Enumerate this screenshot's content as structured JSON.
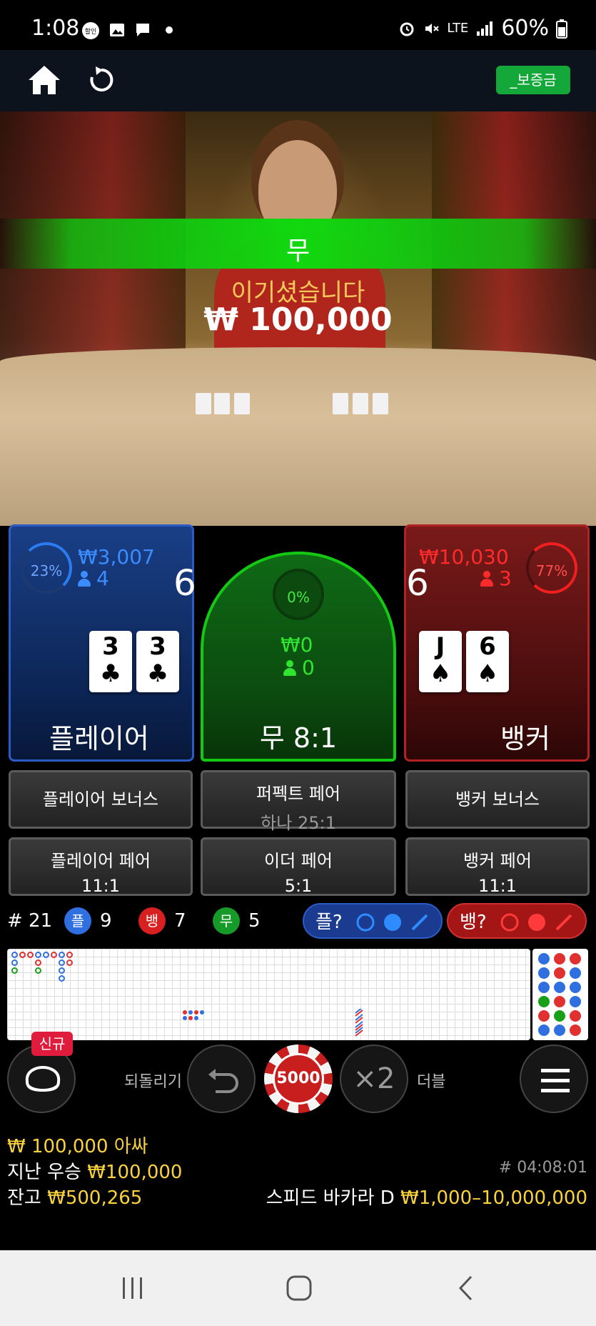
{
  "status_bar": {
    "time": "1:08",
    "network": "LTE",
    "battery": "60%"
  },
  "nav": {
    "deposit_label": "_보증금"
  },
  "video": {
    "result": "무",
    "win_label": "이기셨습니다",
    "win_amount": "₩ 100,000"
  },
  "player": {
    "percent": "23%",
    "amount": "₩3,007",
    "count": "4",
    "score": "6",
    "cards": [
      {
        "rank": "3",
        "suit": "♣"
      },
      {
        "rank": "3",
        "suit": "♣"
      }
    ],
    "label": "플레이어"
  },
  "tie": {
    "percent": "0%",
    "amount": "₩0",
    "count": "0",
    "label": "무 8:1"
  },
  "banker": {
    "percent": "77%",
    "amount": "₩10,030",
    "count": "3",
    "score": "6",
    "cards": [
      {
        "rank": "J",
        "suit": "♠"
      },
      {
        "rank": "6",
        "suit": "♠"
      }
    ],
    "label": "뱅커"
  },
  "side_bets": {
    "player_bonus": "플레이어 보너스",
    "perfect_pair": "퍼펙트 페어",
    "perfect_pair_sub": "하나 25:1",
    "banker_bonus": "뱅커 보너스",
    "player_pair": "플레이어 페어",
    "player_pair_odds": "11:1",
    "either_pair": "이더 페어",
    "either_pair_odds": "5:1",
    "banker_pair": "뱅커 페어",
    "banker_pair_odds": "11:1"
  },
  "stats": {
    "round": "# 21",
    "player_icon": "플",
    "player_count": "9",
    "banker_icon": "뱅",
    "banker_count": "7",
    "tie_icon": "무",
    "tie_count": "5",
    "ask_player": "플?",
    "ask_banker": "뱅?"
  },
  "controls": {
    "new_badge": "신규",
    "undo_label": "되돌리기",
    "chip_value": "5000",
    "double_symbol": "×2",
    "double_label": "더블"
  },
  "info": {
    "bet_amount": "₩ 100,000",
    "bet_suffix": "아싸",
    "last_win_label": "지난 우승",
    "last_win_amount": "₩100,000",
    "balance_label": "잔고",
    "balance_amount": "₩500,265",
    "game_id": "# 04:08:01",
    "table_name": "스피드 바카라 D",
    "limits": "₩1,000–10,000,000"
  },
  "colors": {
    "player": "#2b5bc9",
    "banker": "#b12222",
    "tie": "#14c914",
    "accent_yellow": "#f9d23c"
  },
  "icons": [
    "home-icon",
    "refresh-icon",
    "undo-icon",
    "menu-icon",
    "hat-icon"
  ]
}
